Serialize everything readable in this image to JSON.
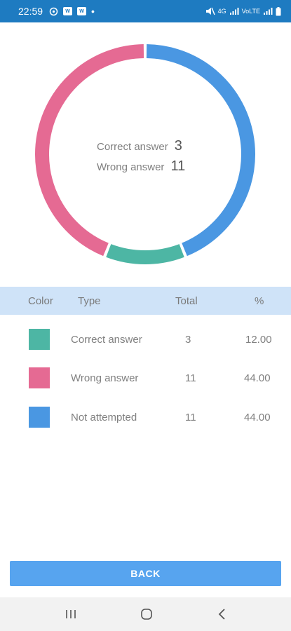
{
  "status_bar": {
    "time": "22:59",
    "left_icons": [
      "sync-icon",
      "app-notification-icon",
      "app-notification-icon",
      "dot-icon"
    ],
    "right_icons": [
      "mute-icon",
      "wifi-signal-icon",
      "signal-icon",
      "volte-icon",
      "signal-icon",
      "battery-icon"
    ],
    "left_box_label": "W",
    "net_label": "4G",
    "volte_label": "VoLTE",
    "dot": "•"
  },
  "summary": {
    "correct_label": "Correct answer",
    "correct_value": "3",
    "wrong_label": "Wrong answer",
    "wrong_value": "11"
  },
  "chart_data": {
    "type": "pie",
    "style": "donut",
    "series": [
      {
        "name": "Correct answer",
        "value": 3,
        "percent": 12.0,
        "color": "#4db6a4"
      },
      {
        "name": "Wrong answer",
        "value": 11,
        "percent": 44.0,
        "color": "#e56a93"
      },
      {
        "name": "Not attempted",
        "value": 11,
        "percent": 44.0,
        "color": "#4a97e2"
      }
    ]
  },
  "table": {
    "headers": {
      "color": "Color",
      "type": "Type",
      "total": "Total",
      "percent": "%"
    },
    "rows": [
      {
        "color": "#4db6a4",
        "type": "Correct answer",
        "total": "3",
        "percent": "12.00"
      },
      {
        "color": "#e56a93",
        "type": "Wrong answer",
        "total": "11",
        "percent": "44.00"
      },
      {
        "color": "#4a97e2",
        "type": "Not attempted",
        "total": "11",
        "percent": "44.00"
      }
    ]
  },
  "back_button": {
    "label": "BACK",
    "color": "#57a4ef"
  },
  "nav_bar": {
    "icons": [
      "recent-apps-icon",
      "home-icon",
      "back-icon"
    ]
  }
}
